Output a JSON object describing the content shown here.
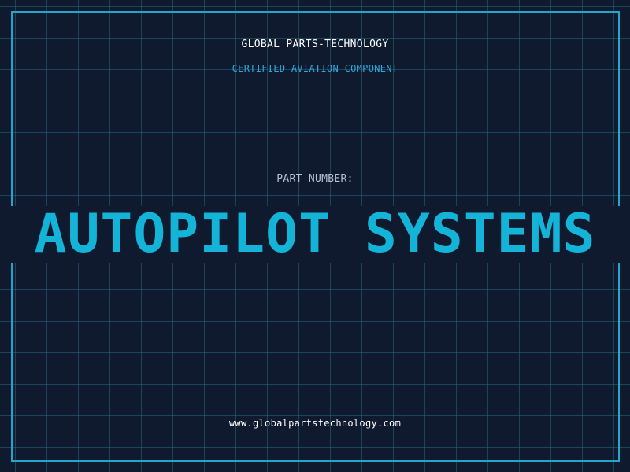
{
  "header": {
    "company": "GLOBAL PARTS-TECHNOLOGY",
    "subtitle": "CERTIFIED AVIATION COMPONENT"
  },
  "part": {
    "label": "PART NUMBER:",
    "name": "AUTOPILOT SYSTEMS"
  },
  "footer": {
    "url": "www.globalpartstechnology.com"
  },
  "colors": {
    "background": "#0f1a2e",
    "accent": "#14b4d8",
    "frame": "#23a6c9",
    "subtitle": "#2ea8dc",
    "text": "#ffffff"
  }
}
